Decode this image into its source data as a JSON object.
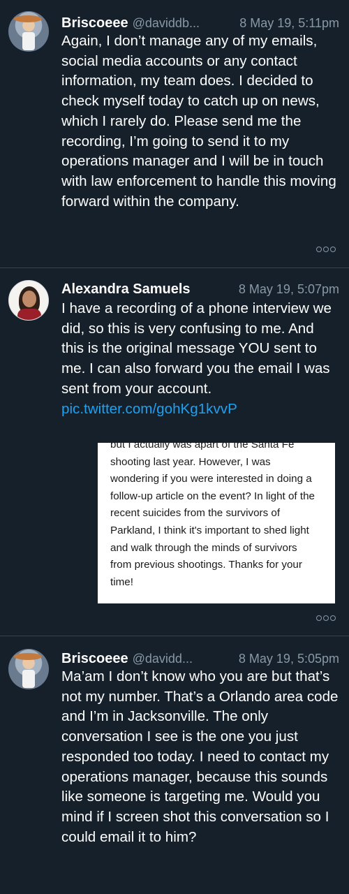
{
  "tweets": [
    {
      "name": "Briscoeee",
      "handle": "@daviddb...",
      "time": "8 May 19, 5:11pm",
      "text": "Again, I don’t manage any of my emails, social media accounts or any contact information, my team does. I decided to check myself today to catch up on news, which I rarely do. Please send me the recording, I’m going to send it to my operations manager and I will be in touch with law enforcement to handle this moving forward within the company."
    },
    {
      "name": "Alexandra Samuels",
      "handle": "",
      "time": "8 May 19, 5:07pm",
      "text": "I have a recording of a phone interview we did, so this is very confusing to me. And this is the original message YOU sent to me. I can also forward you the email I was sent from your account.",
      "link": "pic.twitter.com/gohKg1kvvP",
      "media_text": "but I actually was apart of the Santa Fe shooting last year. However, I was wondering if you were interested in doing a follow-up article on the event? In light of the recent suicides from the survivors of Parkland, I think it's important to shed light and walk through the minds of survivors from previous shootings. Thanks for your time!"
    },
    {
      "name": "Briscoeee",
      "handle": "@davidd...",
      "time": "8 May 19, 5:05pm",
      "text": "Ma’am I don’t know who you are but that’s not my number. That’s a Orlando area code and I’m in Jacksonville. The only conversation I see is the one you just responded too today. I need to contact my operations manager, because this sounds like someone is targeting me. Would you mind if I screen shot this conversation so I could email it to him?"
    }
  ],
  "icons": {
    "avatar_briscoeee": "avatar",
    "avatar_alexandra": "avatar",
    "more": "more-options-icon"
  },
  "colors": {
    "background": "#15202b",
    "secondary_text": "#8899a6",
    "link": "#1da1f2",
    "divider": "#38444d"
  }
}
